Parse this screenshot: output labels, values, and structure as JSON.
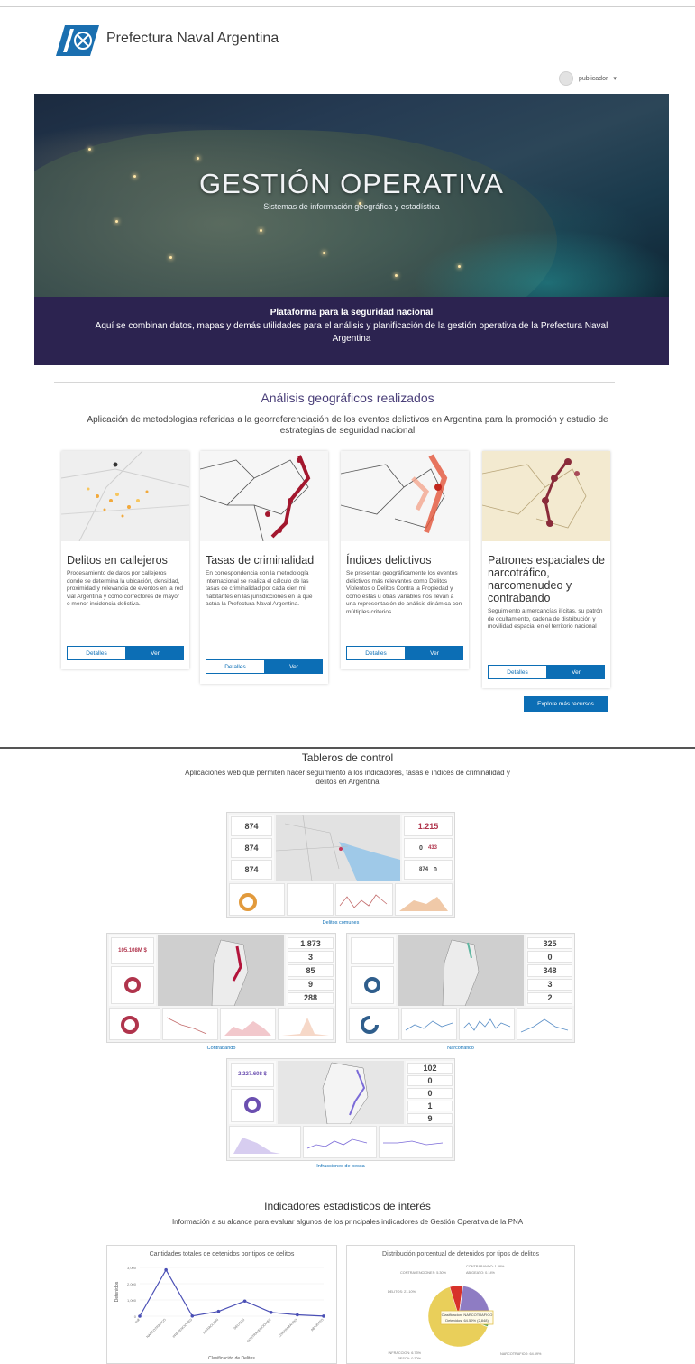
{
  "header": {
    "brand": "Prefectura Naval Argentina",
    "user": "publicador",
    "user_caret": "▾"
  },
  "hero": {
    "title": "GESTIÓN OPERATIVA",
    "subtitle": "Sistemas de información geográfica y estadística"
  },
  "banner": {
    "title": "Plataforma para la seguridad nacional",
    "text": "Aquí se combinan datos, mapas y demás utilidades para el análisis y planificación de la gestión operativa de la Prefectura Naval Argentina"
  },
  "analysis": {
    "title": "Análisis geográficos realizados",
    "subtitle": "Aplicación de metodologías referidas a la georreferenciación de los eventos delictivos en Argentina para la promoción y estudio de estrategias de seguridad nacional",
    "cards": [
      {
        "title": "Delitos en callejeros",
        "text": "Procesamiento de datos por callejeros donde se determina la ubicación, densidad, proximidad y relevancia de eventos en la red vial Argentina y como correctores de mayor o menor incidencia delictiva.",
        "details": "Detalles",
        "view": "Ver"
      },
      {
        "title": "Tasas de criminalidad",
        "text": "En correspondencia con la metodología internacional se realiza el cálculo de las tasas de criminalidad por cada cien mil habitantes en las jurisdicciones en la que actúa la Prefectura Naval Argentina.",
        "details": "Detalles",
        "view": "Ver"
      },
      {
        "title": "Índices delictivos",
        "text": "Se presentan geográficamente los eventos delictivos más relevantes como Delitos Violentos o Delitos Contra la Propiedad y como estas u otras variables nos llevan a una representación de análisis dinámica con múltiples criterios.",
        "details": "Detalles",
        "view": "Ver"
      },
      {
        "title": "Patrones espaciales de narcotráfico, narcomenudeo y contrabando",
        "text": "Seguimiento a mercancías ilícitas, su patrón de ocultamiento, cadena de distribución y movilidad espacial en el territorio nacional",
        "details": "Detalles",
        "view": "Ver"
      }
    ],
    "explore": "Explore más recursos"
  },
  "dashboards": {
    "title": "Tableros de control",
    "subtitle": "Aplicaciones web que permiten hacer seguimiento a los indicadores, tasas e índices de criminalidad y delitos en Argentina",
    "items": [
      {
        "caption": "Delitos comunes",
        "kpis_left": [
          "874",
          "874",
          "874"
        ],
        "kpis_right": [
          "1.215",
          "0",
          "433",
          "874",
          "0"
        ]
      },
      {
        "caption": "Contrabando",
        "value_left": "105.108M $",
        "kpis_right": [
          "1.873",
          "3",
          "85",
          "9",
          "288"
        ]
      },
      {
        "caption": "Narcotráfico",
        "kpis_right": [
          "325",
          "0",
          "348",
          "3",
          "2"
        ]
      },
      {
        "caption": "Infracciones de pesca",
        "value_left": "2.227.608 $",
        "kpis_right": [
          "102",
          "0",
          "0",
          "1",
          "9"
        ]
      }
    ]
  },
  "indicators": {
    "title": "Indicadores estadísticos de interés",
    "subtitle": "Información a su alcance para evaluar algunos de los principales indicadores de Gestión Operativa de la PNA",
    "chart1_title": "Cantidades totales de detenidos por tipos de delitos",
    "chart2_title": "Distribución porcentual de detenidos por tipos de delitos",
    "chart1_ylabel": "Detenidos",
    "chart1_xlabel": "Clasificación de Delitos",
    "tooltip_line1": "Clasificacion: NARCOTRAFICO",
    "tooltip_line2": "Detenidos: 64.59% (2,848)",
    "pie_labels": [
      "CONTRABANDO: 1.88%",
      "ABIGEATO: 0.14%",
      "CONTRAVENCIONES: 5.30%",
      "DELITOS: 21.10%",
      "INFRACCION: 6.73%",
      "PESCA: 0.30%",
      "NARCOTRAFICO: 64.59%"
    ]
  },
  "chart_data": [
    {
      "type": "line",
      "title": "Cantidades totales de detenidos por tipos de delitos",
      "xlabel": "Clasificación de Delitos",
      "ylabel": "Detenidos",
      "categories": [
        "null",
        "NARCOTRAFICO",
        "PREVENCIONES",
        "INFRACCION",
        "DELITOS",
        "CONTRAVENCIONES",
        "CONTRABANDO",
        "ABIGEATO"
      ],
      "values": [
        0,
        2848,
        13,
        297,
        930,
        233,
        83,
        6
      ],
      "ylim": [
        0,
        3000
      ],
      "yticks": [
        "3,000",
        "2,000",
        "1,000",
        "0"
      ],
      "color": "#4a4fb5"
    },
    {
      "type": "pie",
      "title": "Distribución porcentual de detenidos por tipos de delitos",
      "slices": [
        {
          "label": "NARCOTRAFICO",
          "value": 64.59,
          "color": "#e9cf5a"
        },
        {
          "label": "INFRACCION",
          "value": 6.73,
          "color": "#d7322a"
        },
        {
          "label": "PESCA",
          "value": 0.3,
          "color": "#f28e2b"
        },
        {
          "label": "DELITOS",
          "value": 21.1,
          "color": "#8e7cc3"
        },
        {
          "label": "CONTRAVENCIONES",
          "value": 5.3,
          "color": "#4e79a7"
        },
        {
          "label": "CONTRABANDO",
          "value": 1.88,
          "color": "#59a14f"
        },
        {
          "label": "ABIGEATO",
          "value": 0.14,
          "color": "#76b7b2"
        }
      ]
    }
  ]
}
